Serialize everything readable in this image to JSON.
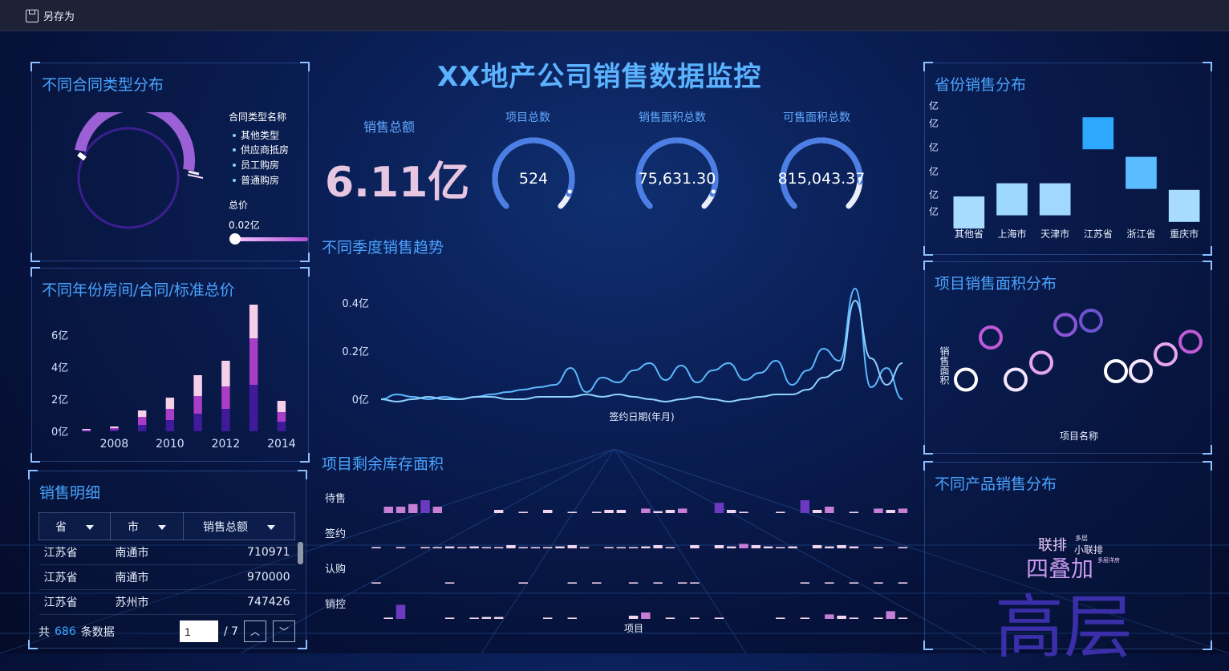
{
  "toolbar": {
    "save_label": "另存为"
  },
  "title": "XX地产公司销售数据监控",
  "contract_panel": {
    "title": "不同合同类型分布",
    "legend_title": "合同类型名称",
    "legend": [
      "其他类型",
      "供应商抵房",
      "员工购房",
      "普通购房"
    ],
    "slider_title": "总价",
    "slider_value": "0.02亿"
  },
  "year_panel": {
    "title": "不同年份房间/合同/标准总价",
    "chart_data": {
      "type": "bar",
      "x": [
        2007,
        2008,
        2009,
        2010,
        2011,
        2012,
        2013,
        2014
      ],
      "xticks": [
        "2008",
        "2010",
        "2012",
        "2014"
      ],
      "yticks": [
        "0亿",
        "2亿",
        "4亿",
        "6亿"
      ],
      "ylim": [
        0,
        7
      ],
      "series": [
        {
          "values": [
            0.05,
            0.1,
            0.4,
            0.7,
            1.1,
            1.4,
            2.9,
            0.6
          ]
        },
        {
          "values": [
            0.05,
            0.1,
            0.5,
            0.7,
            1.1,
            1.4,
            2.9,
            0.6
          ]
        },
        {
          "values": [
            0.05,
            0.1,
            0.4,
            0.7,
            1.3,
            1.6,
            3.1,
            0.7
          ]
        }
      ],
      "colors": [
        "#3f1a99",
        "#a83ec6",
        "#f6cfe8"
      ]
    }
  },
  "detail_panel": {
    "title": "销售明细",
    "columns": [
      "省",
      "市",
      "销售总额"
    ],
    "rows": [
      [
        "江苏省",
        "南通市",
        "710971"
      ],
      [
        "江苏省",
        "南通市",
        "970000"
      ],
      [
        "江苏省",
        "苏州市",
        "747426"
      ]
    ],
    "pager": {
      "prefix": "共",
      "count": "686",
      "suffix": "条数据",
      "page": "1",
      "total": "/ 7"
    }
  },
  "kpis": {
    "sales_label": "销售总额",
    "sales_value": "6.11亿",
    "gauges": [
      {
        "label": "项目总数",
        "value": "524",
        "fraction": 0.92
      },
      {
        "label": "销售面积总数",
        "value": "75,631.30",
        "fraction": 0.92
      },
      {
        "label": "可售面积总数",
        "value": "815,043.37",
        "fraction": 0.85
      }
    ]
  },
  "trend_panel": {
    "title": "不同季度销售趋势",
    "chart_data": {
      "type": "line",
      "xlabel": "签约日期(年月)",
      "yticks": [
        "0亿",
        "0.2亿",
        "0.4亿"
      ],
      "ylim": [
        0,
        0.5
      ],
      "series": [
        {
          "values": [
            0.0,
            0.02,
            0.01,
            0.0,
            0.01,
            0.0,
            0.01,
            0.02,
            0.03,
            0.04,
            0.05,
            0.06,
            0.13,
            0.03,
            0.09,
            0.07,
            0.12,
            0.15,
            0.08,
            0.14,
            0.07,
            0.12,
            0.15,
            0.08,
            0.11,
            0.16,
            0.06,
            0.12,
            0.21,
            0.16,
            0.46,
            0.05,
            0.13,
            0.0
          ]
        },
        {
          "values": [
            0.0,
            -0.01,
            0.0,
            0.01,
            0.0,
            0.0,
            0.01,
            0.01,
            0.0,
            0.0,
            0.01,
            0.01,
            0.01,
            0.02,
            0.01,
            0.02,
            0.01,
            0.0,
            -0.01,
            0.0,
            0.01,
            0.0,
            -0.01,
            0.0,
            0.01,
            0.02,
            0.02,
            0.04,
            0.09,
            0.12,
            0.41,
            0.17,
            0.06,
            0.15
          ]
        }
      ],
      "colors": [
        "#5bb8ff",
        "#8fd3ff"
      ]
    }
  },
  "inventory_panel": {
    "title": "项目剩余库存面积",
    "rows": [
      "待售",
      "签约",
      "认购",
      "销控"
    ],
    "xlabel": "项目"
  },
  "province_panel": {
    "title": "省份销售分布",
    "y_labels": [
      "亿",
      "亿",
      "亿",
      "亿",
      "亿",
      "亿"
    ],
    "chart_data": {
      "type": "bar",
      "categories": [
        "其他省",
        "上海市",
        "天津市",
        "江苏省",
        "浙江省",
        "重庆市"
      ],
      "values": [
        0.4,
        0.6,
        0.6,
        1.6,
        1.0,
        0.5
      ],
      "colors": [
        "#a7dcff",
        "#9ed7ff",
        "#a1d8ff",
        "#2ea8ff",
        "#5bbcff",
        "#a7dcff"
      ]
    }
  },
  "area_panel": {
    "title": "项目销售面积分布",
    "ylabel": "销售面积",
    "xlabel": "项目名称",
    "chart_data": {
      "type": "scatter",
      "x": [
        1,
        2,
        3,
        4,
        5,
        6,
        7,
        8,
        9,
        10
      ],
      "y": [
        0.3,
        0.8,
        0.3,
        0.5,
        0.95,
        1.0,
        0.4,
        0.4,
        0.6,
        0.75
      ],
      "colors": [
        "#ffffff",
        "#c05ad8",
        "#f5e6ff",
        "#e7a5f0",
        "#8a54d6",
        "#6d53cf",
        "#ffffff",
        "#f5e6ff",
        "#e7a5f0",
        "#c05ad8"
      ]
    }
  },
  "product_panel": {
    "title": "不同产品销售分布",
    "words": [
      "高层",
      "四叠加",
      "联排",
      "小联排",
      "多层",
      "多层洋房"
    ]
  }
}
